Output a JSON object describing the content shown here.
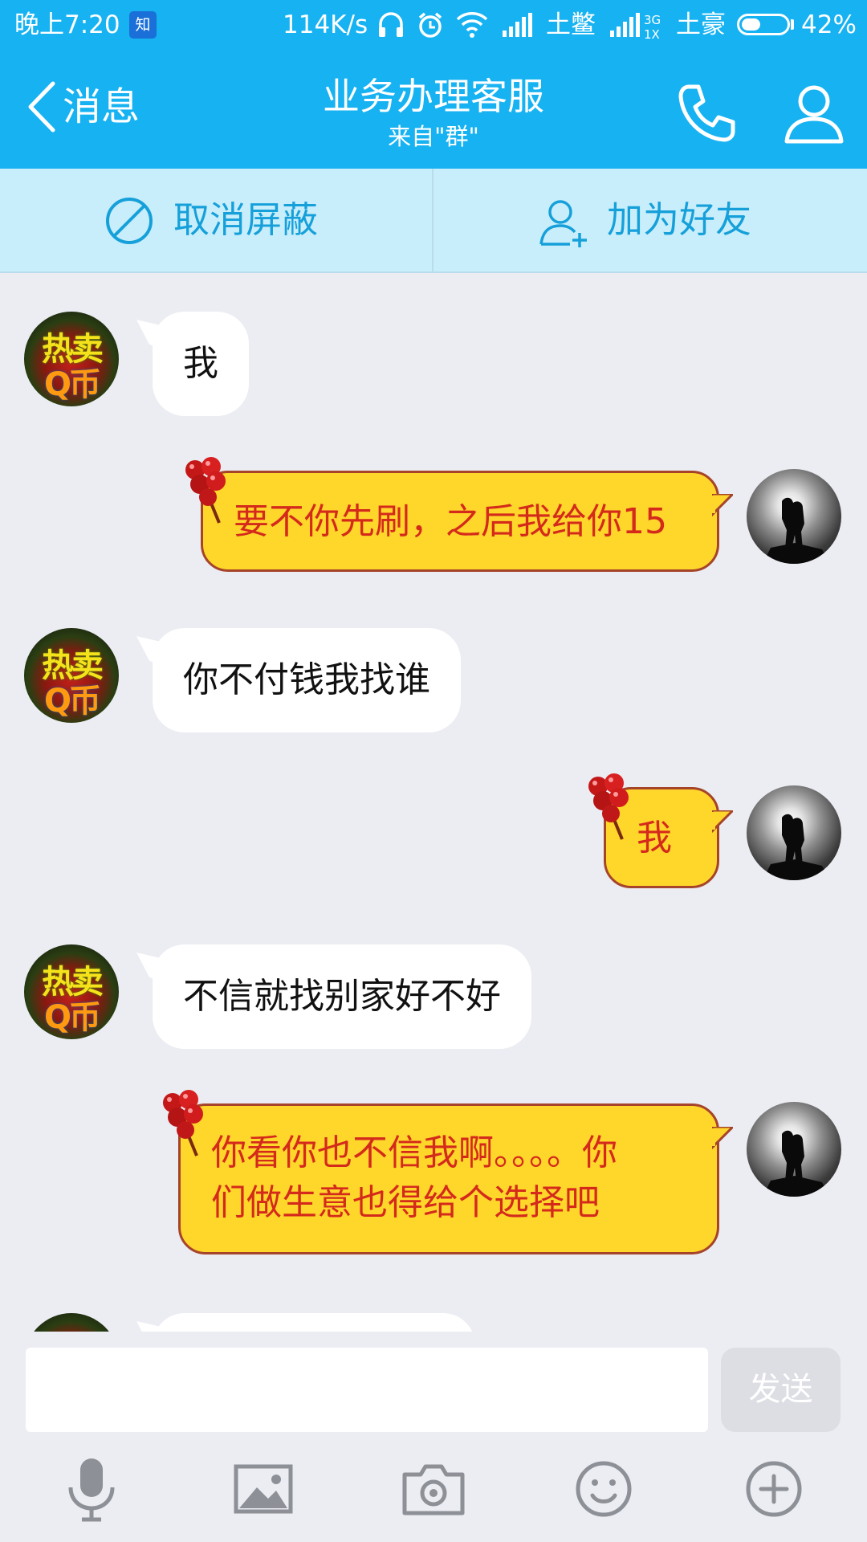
{
  "colors": {
    "header_bg": "#16b2f2",
    "action_bar_bg": "#c9eefb",
    "action_text": "#16a0da",
    "chat_bg": "#ebedf2",
    "my_bubble_bg": "#ffd62a",
    "my_bubble_text": "#d42a1c",
    "their_bubble_bg": "#ffffff"
  },
  "status_bar": {
    "time": "晚上7:20",
    "app_badge": "知",
    "net_speed": "114K/s",
    "icons": [
      "headset-icon",
      "alarm-icon",
      "wifi-icon",
      "signal-icon",
      "signal-3g-icon"
    ],
    "carrier1": "土鳖",
    "network_type": "3G 1X",
    "carrier2": "土豪",
    "battery_percent": "42%",
    "battery_level": 0.42
  },
  "header": {
    "back_label": "消息",
    "title": "业务办理客服",
    "subtitle": "来自\"群\"",
    "call_icon": "phone-icon",
    "profile_icon": "person-icon"
  },
  "actions": {
    "unblock_label": "取消屏蔽",
    "add_friend_label": "加为好友"
  },
  "messages": [
    {
      "from": "them",
      "text": "我"
    },
    {
      "from": "me",
      "text": "要不你先刷，之后我给你15"
    },
    {
      "from": "them",
      "text": "你不付钱我找谁"
    },
    {
      "from": "me",
      "text": "我"
    },
    {
      "from": "them",
      "text": "不信就找别家好不好"
    },
    {
      "from": "me",
      "text": "你看你也不信我啊。。。。你\n们做生意也得给个选择吧"
    }
  ],
  "their_avatar": {
    "line1": "热卖",
    "line2": "Q币"
  },
  "composer": {
    "input_value": "",
    "send_label": "发送"
  },
  "toolbar_icons": [
    "microphone-icon",
    "image-icon",
    "camera-icon",
    "emoji-icon",
    "plus-icon"
  ]
}
